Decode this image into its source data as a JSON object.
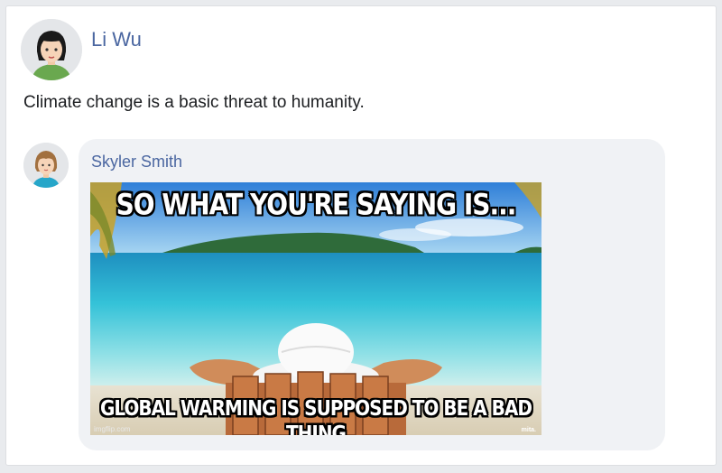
{
  "post": {
    "author": "Li Wu",
    "avatar_icon": "woman-dark-hair-avatar-icon",
    "text": "Climate change is a basic threat to humanity."
  },
  "comment": {
    "author": "Skyler Smith",
    "avatar_icon": "woman-brown-hair-avatar-icon",
    "meme": {
      "top_text": "SO WHAT YOU'RE SAYING IS...",
      "bottom_text": "GLOBAL WARMING IS SUPPOSED TO BE A BAD THING",
      "watermark": "imgflip.com",
      "watermark_right": "mita."
    }
  },
  "colors": {
    "name_link": "#4b67a1",
    "bubble": "#f0f2f5"
  }
}
